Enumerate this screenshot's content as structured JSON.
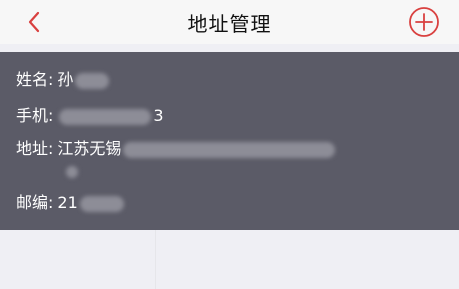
{
  "nav": {
    "title": "地址管理",
    "back_icon": "chevron-left-icon",
    "add_icon": "plus-circle-icon"
  },
  "address": {
    "name_label": "姓名:",
    "name_value": "孙",
    "phone_label": "手机:",
    "phone_value": "3",
    "address_label": "地址:",
    "address_value": "江苏无锡",
    "zip_label": "邮编:",
    "zip_value": "21"
  },
  "colors": {
    "accent": "#d9403f",
    "card_bg": "#5b5b67",
    "page_bg": "#efeff4"
  }
}
